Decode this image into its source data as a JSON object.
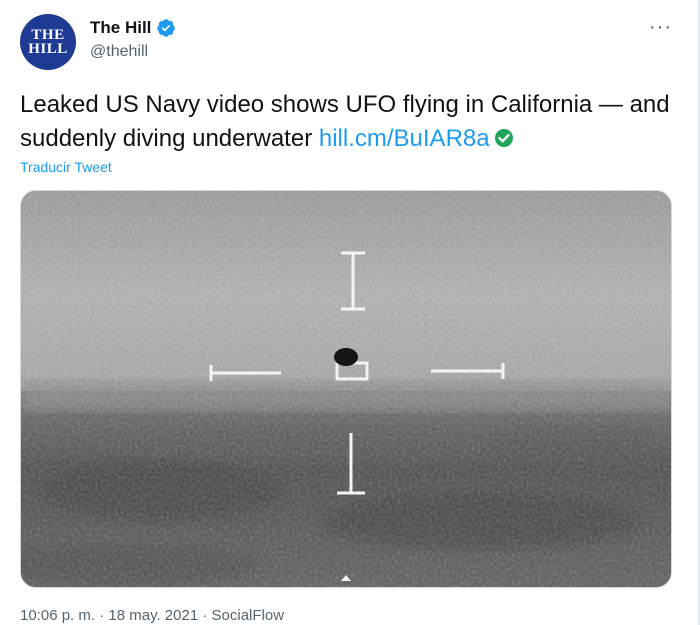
{
  "account": {
    "display_name": "The Hill",
    "handle": "@thehill",
    "avatar_line1": "THE",
    "avatar_line2": "HILL"
  },
  "tweet": {
    "text": "Leaked US Navy video shows UFO flying in California — and suddenly diving underwater ",
    "link_text": "hill.cm/BuIAR8a",
    "translate_label": "Traducir Tweet",
    "more_label": "···"
  },
  "footer": {
    "time": "10:06 p. m.",
    "separator1": " · ",
    "date": "18 may. 2021",
    "separator2": " · ",
    "source": "SocialFlow"
  },
  "colors": {
    "link": "#1d9bf0",
    "verified": "#1d9bf0",
    "check_green": "#21a55a",
    "avatar_bg": "#1f3a93"
  },
  "icons": {
    "verified": "verified-badge-icon",
    "more": "more-options-icon",
    "link_check": "green-check-icon"
  }
}
